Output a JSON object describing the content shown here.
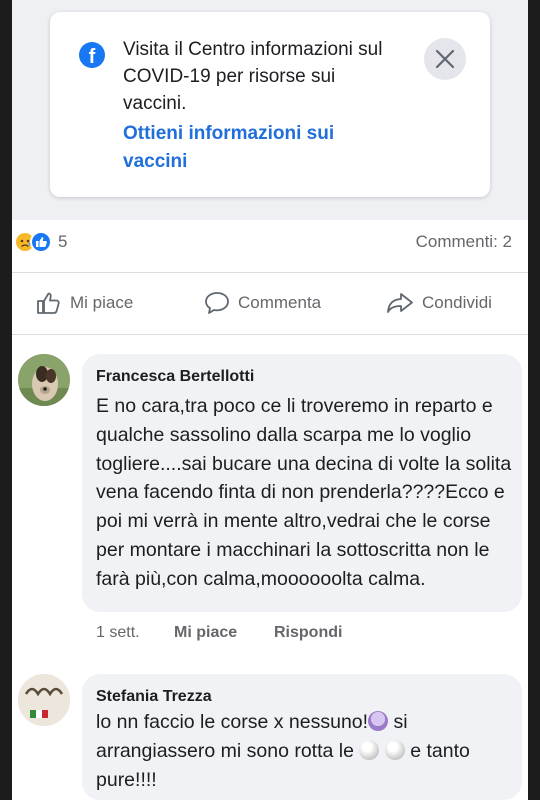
{
  "covid_card": {
    "message": "Visita il Centro informazioni sul COVID-19 per risorse sui vaccini.",
    "link_text": "Ottieni informazioni sui vaccini"
  },
  "post_stats": {
    "reaction_count": "5",
    "comments": "Commenti: 2"
  },
  "actions": {
    "like": "Mi piace",
    "comment": "Commenta",
    "share": "Condividi"
  },
  "comments": [
    {
      "author": "Francesca Bertellotti",
      "text": "E no cara,tra poco ce li troveremo in reparto e qualche sassolino dalla scarpa me lo voglio togliere....sai bucare una decina di volte la solita vena facendo finta di non prenderla????Ecco e poi mi verrà in mente altro,vedrai che le corse per montare i macchinari la sottoscritta non le farà più,con calma,moooooolta calma.",
      "time": "1 sett.",
      "like_label": "Mi piace",
      "reply_label": "Rispondi"
    },
    {
      "author": "Stefania Trezza",
      "text_part1": "lo nn faccio le corse x nessuno!",
      "text_part2": " si arrangiassero mi sono rotta le ",
      "text_part3": " e tanto pure!!!!"
    }
  ]
}
